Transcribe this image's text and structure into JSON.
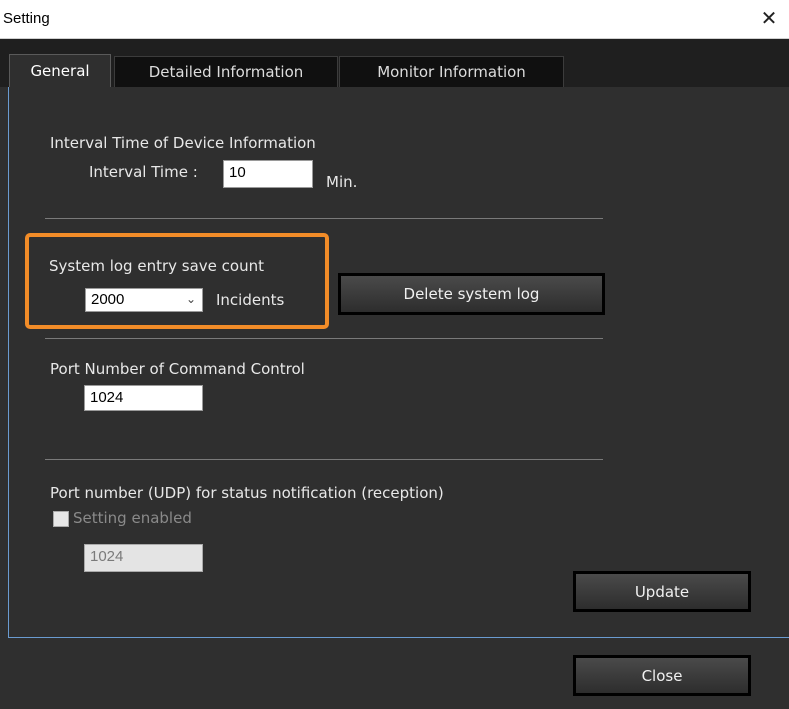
{
  "window": {
    "title": "Setting",
    "close_glyph": "✕"
  },
  "tabs": [
    {
      "label": "General",
      "active": true
    },
    {
      "label": "Detailed Information",
      "active": false
    },
    {
      "label": "Monitor Information",
      "active": false
    }
  ],
  "interval": {
    "heading": "Interval Time of Device Information",
    "field_label": "Interval Time :",
    "value": "10",
    "unit": "Min."
  },
  "system_log": {
    "heading": "System log entry save count",
    "selected": "2000",
    "unit": "Incidents",
    "delete_button": "Delete system log",
    "highlight_color": "#f28c28"
  },
  "command_port": {
    "heading": "Port Number of Command Control",
    "value": "1024"
  },
  "udp_port": {
    "heading": "Port number (UDP) for status notification (reception)",
    "checkbox_label": "Setting enabled",
    "checked": false,
    "value": "1024"
  },
  "buttons": {
    "update": "Update",
    "close": "Close"
  },
  "colors": {
    "background": "#2f2f2f",
    "tabstrip": "#1f1f1f",
    "accent": "#f28c28"
  }
}
